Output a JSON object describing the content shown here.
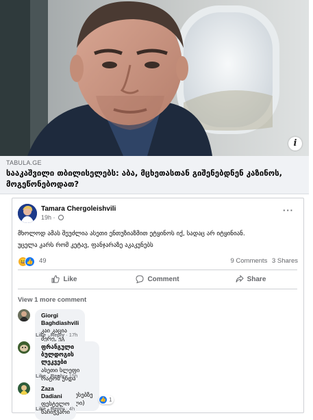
{
  "link_preview": {
    "info_icon": "i",
    "domain": "TABULA.GE",
    "headline": "სააკაშვილი თბილისელებს: აბა, მცხეთასთან გიშენებდნენ კაზინოს, მოგეწონებოდათ?"
  },
  "post": {
    "author": "Tamara Chergoleishvili",
    "time": "19h",
    "separator": "·",
    "more_menu": "···",
    "text_line1": "მხოლოდ ამას შეუძლია ასეთი ენთუზიაზმით ეტყინოს იქ, სადაც არ იტყინიან.",
    "text_line2": "უცელა კარს რომ კეტავ, ფანჯარაზე აკაკუნებს",
    "reactions": {
      "count": "49",
      "icons": [
        "haha-icon",
        "like-icon"
      ]
    },
    "comments_count": "9 Comments",
    "shares_count": "3 Shares",
    "actions": {
      "like": "Like",
      "comment": "Comment",
      "share": "Share"
    },
    "view_more": "View 1 more comment",
    "comments": [
      {
        "name": "Giorgi Baghdiashvili",
        "text": "კაი კაცია მერე, ეგ არის ნამდვილი მეგობრობა 😁😁",
        "like": "Like",
        "reply": "Reply",
        "time": "17h"
      },
      {
        "name": "ფრანგული ბულდოგის ლეკვები",
        "text_line1": "ასეთი სლეფი რატომ უნდა გადიილოს ადამიანმა(ჰესებზე",
        "text_line2": "გაარჩენიშული)",
        "like": "Like",
        "reply": "Reply",
        "time": "15h"
      },
      {
        "name": "Zaza Dadiani",
        "text": "ფესტელო ნაჩიჭვარი",
        "like": "Like",
        "reply": "Reply",
        "time": "4h",
        "like_count": "1"
      }
    ]
  },
  "colors": {
    "link_bg": "#f0f2f5",
    "facebook_blue": "#1877f2",
    "secondary_text": "#65676b",
    "bubble_bg": "#f0f2f5"
  }
}
